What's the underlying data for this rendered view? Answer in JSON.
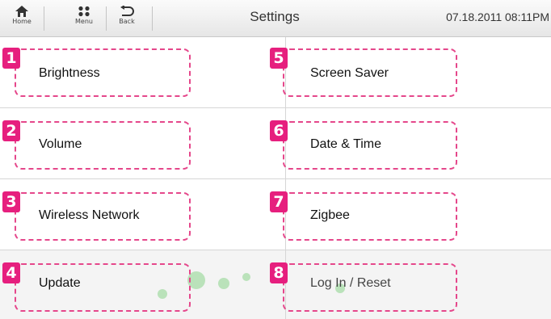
{
  "header": {
    "nav": [
      {
        "label": "Home",
        "icon": "home-icon"
      },
      {
        "label": "Menu",
        "icon": "menu-icon"
      },
      {
        "label": "Back",
        "icon": "back-icon"
      }
    ],
    "title": "Settings",
    "datetime": "07.18.2011 08:11PM"
  },
  "settings": {
    "left": [
      {
        "label": "Brightness",
        "badge": "1"
      },
      {
        "label": "Volume",
        "badge": "2"
      },
      {
        "label": "Wireless Network",
        "badge": "3"
      },
      {
        "label": "Update",
        "badge": "4"
      }
    ],
    "right": [
      {
        "label": "Screen Saver",
        "badge": "5"
      },
      {
        "label": "Date & Time",
        "badge": "6"
      },
      {
        "label": "Zigbee",
        "badge": "7"
      },
      {
        "label": "Log In / Reset",
        "badge": "8"
      }
    ]
  },
  "colors": {
    "annotation": "#e5478b",
    "badge": "#e61f7e"
  }
}
